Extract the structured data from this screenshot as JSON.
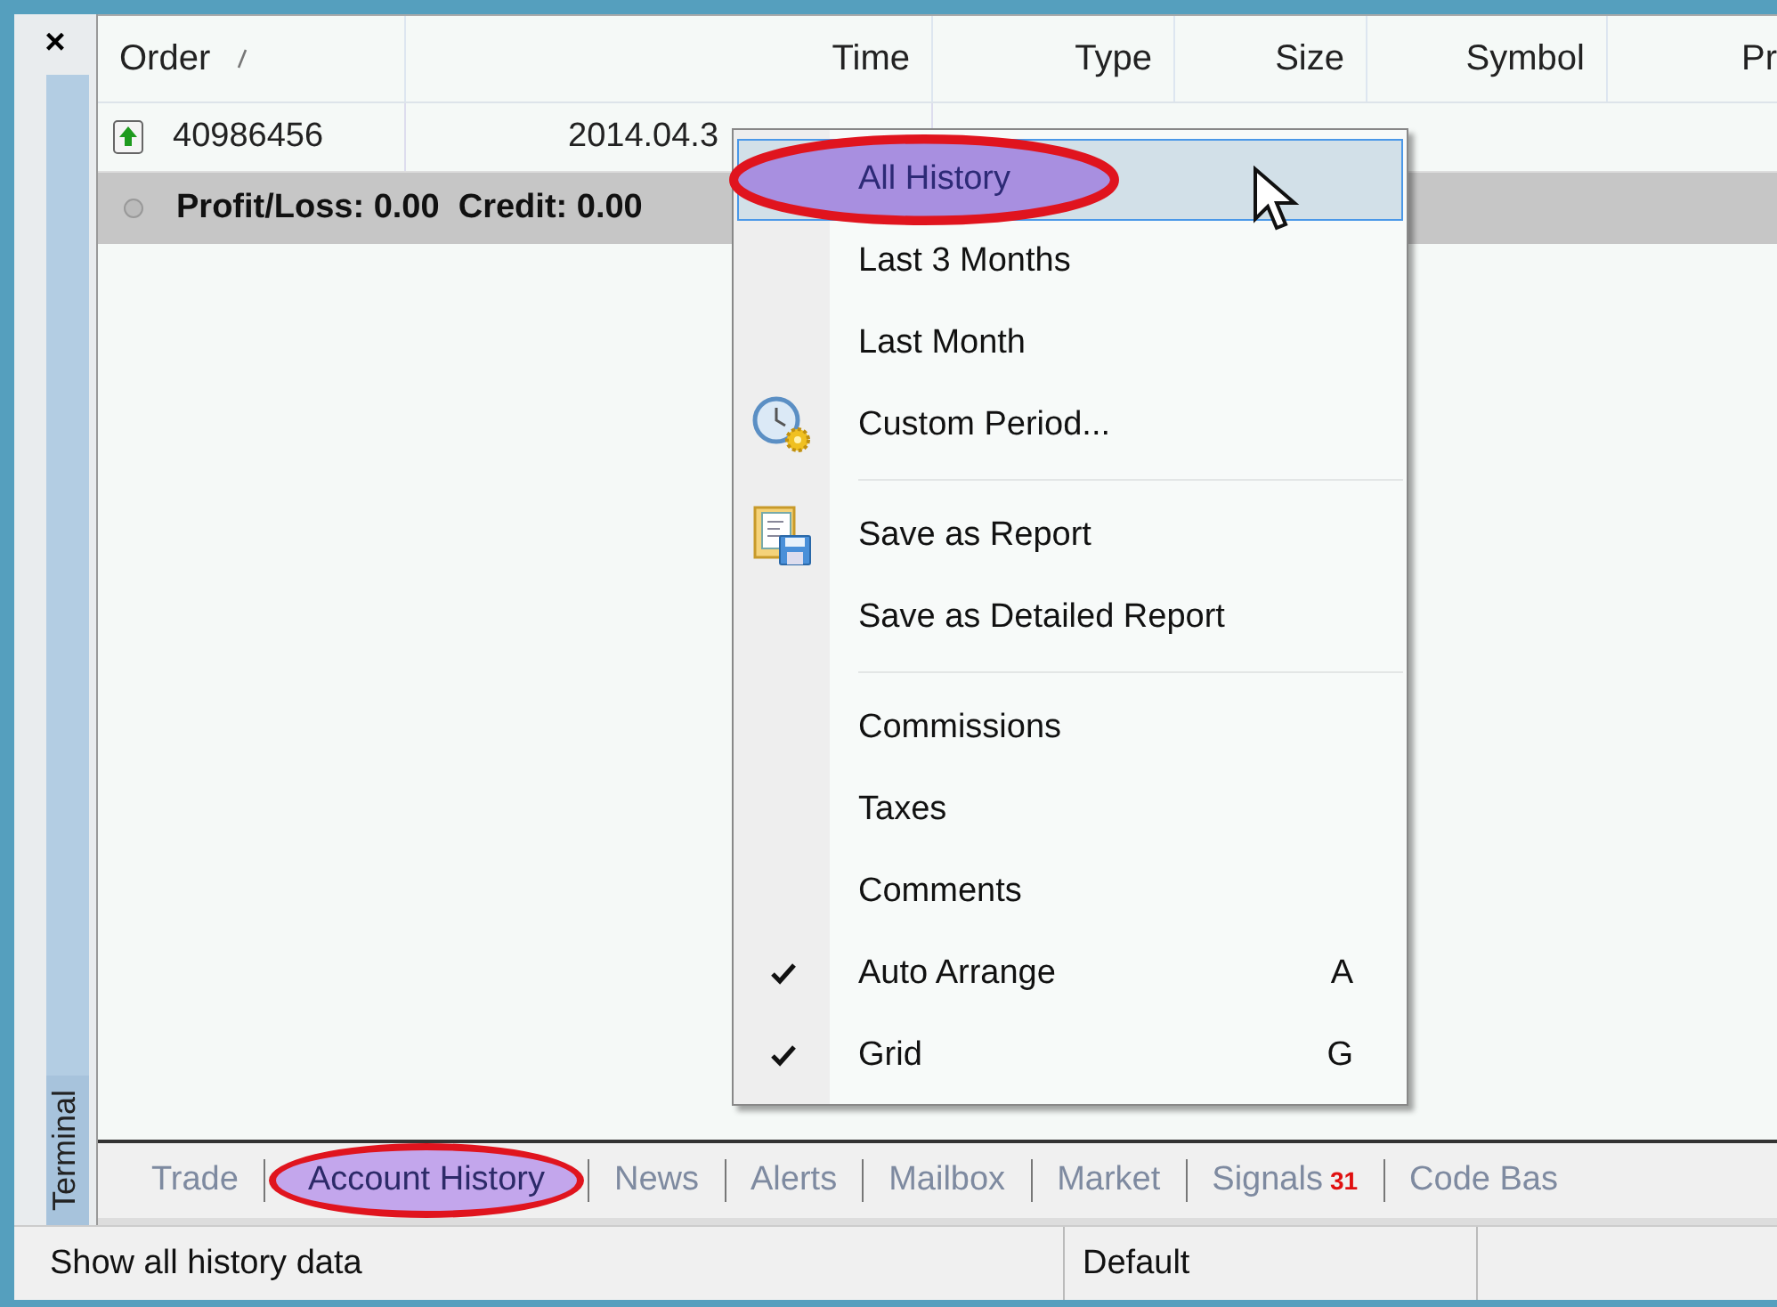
{
  "panel": {
    "close": "×",
    "side_tab": "Terminal"
  },
  "table": {
    "columns": [
      {
        "label": "Order",
        "sorted": true
      },
      {
        "label": "Time",
        "sorted": false
      },
      {
        "label": "Type",
        "sorted": false
      },
      {
        "label": "Size",
        "sorted": false
      },
      {
        "label": "Symbol",
        "sorted": false
      },
      {
        "label": "Pr",
        "sorted": false
      }
    ],
    "rows": [
      {
        "kind": "order",
        "cells": [
          "40986456",
          "2014.04.3"
        ]
      },
      {
        "kind": "summary",
        "text": "Profit/Loss: 0.00  Credit: 0.00"
      }
    ]
  },
  "context_menu": {
    "items": [
      {
        "kind": "item",
        "label": "All History",
        "selected": true,
        "highlighted": true,
        "checked": false
      },
      {
        "kind": "item",
        "label": "Last 3 Months",
        "selected": false,
        "highlighted": false,
        "checked": false
      },
      {
        "kind": "item",
        "label": "Last Month",
        "selected": false,
        "highlighted": false,
        "checked": false
      },
      {
        "kind": "clock-item",
        "label": "Custom Period...",
        "selected": false,
        "highlighted": false,
        "checked": false
      },
      {
        "kind": "separator"
      },
      {
        "kind": "save-item",
        "label": "Save as Report",
        "selected": false,
        "highlighted": false,
        "checked": false
      },
      {
        "kind": "item",
        "label": "Save as Detailed Report",
        "selected": false,
        "highlighted": false,
        "checked": false
      },
      {
        "kind": "separator"
      },
      {
        "kind": "item",
        "label": "Commissions",
        "selected": false,
        "highlighted": false,
        "checked": false
      },
      {
        "kind": "item",
        "label": "Taxes",
        "selected": false,
        "highlighted": false,
        "checked": false
      },
      {
        "kind": "item",
        "label": "Comments",
        "selected": false,
        "highlighted": false,
        "checked": false
      },
      {
        "kind": "item",
        "label": "Auto Arrange",
        "selected": false,
        "highlighted": false,
        "checked": true,
        "shortcut": "A"
      },
      {
        "kind": "item",
        "label": "Grid",
        "selected": false,
        "highlighted": false,
        "checked": true,
        "shortcut": "G"
      }
    ]
  },
  "tabs": [
    {
      "label": "Trade",
      "selected": false,
      "highlighted": false
    },
    {
      "label": "Account History",
      "selected": true,
      "highlighted": true
    },
    {
      "label": "News",
      "selected": false,
      "highlighted": false
    },
    {
      "label": "Alerts",
      "selected": false,
      "highlighted": false
    },
    {
      "label": "Mailbox",
      "selected": false,
      "highlighted": false
    },
    {
      "label": "Market",
      "selected": false,
      "highlighted": false
    },
    {
      "label": "Signals",
      "selected": false,
      "highlighted": false,
      "badge": "31"
    },
    {
      "label": "Code Bas",
      "selected": false,
      "highlighted": false
    }
  ],
  "status_bar": [
    "Show all history data",
    "Default"
  ]
}
